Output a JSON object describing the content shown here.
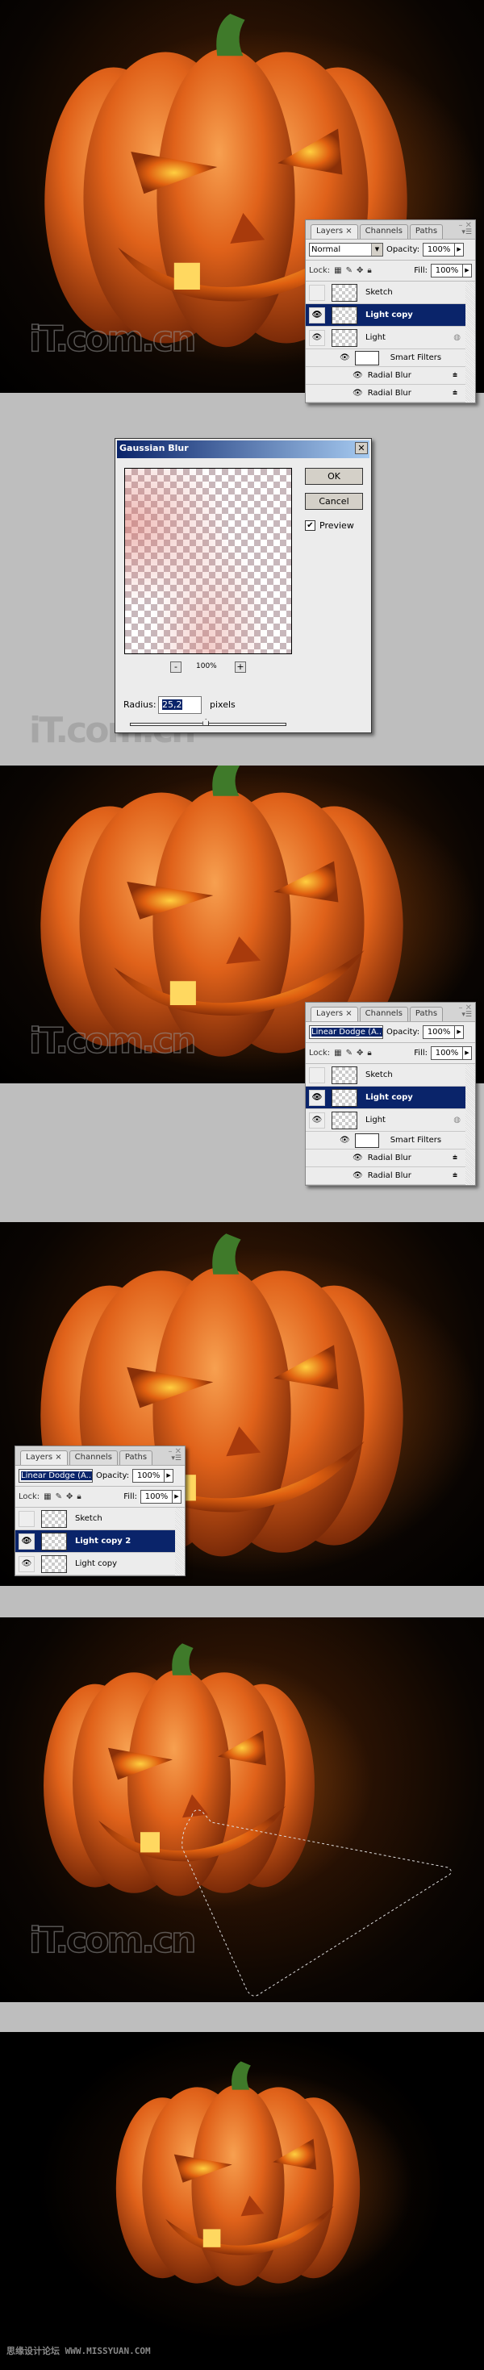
{
  "watermark": "iT.com.cn",
  "footer": {
    "site_cn": "思缘设计论坛",
    "site_url": "WWW.MISSYUAN.COM"
  },
  "layers_panels": [
    {
      "tabs": [
        "Layers ×",
        "Channels",
        "Paths"
      ],
      "blend_mode": "Normal",
      "opacity_label": "Opacity:",
      "opacity": "100%",
      "lock_label": "Lock:",
      "fill_label": "Fill:",
      "fill": "100%",
      "layers": [
        {
          "name": "Sketch",
          "visible": false,
          "selected": false
        },
        {
          "name": "Light copy",
          "visible": true,
          "selected": true
        },
        {
          "name": "Light",
          "visible": true,
          "selected": false,
          "smart": true
        }
      ],
      "smart_filters": "Smart Filters",
      "filters": [
        "Radial Blur",
        "Radial Blur"
      ]
    },
    {
      "tabs": [
        "Layers ×",
        "Channels",
        "Paths"
      ],
      "blend_mode": "Linear Dodge (A...",
      "opacity_label": "Opacity:",
      "opacity": "100%",
      "lock_label": "Lock:",
      "fill_label": "Fill:",
      "fill": "100%",
      "layers": [
        {
          "name": "Sketch",
          "visible": false,
          "selected": false
        },
        {
          "name": "Light copy",
          "visible": true,
          "selected": true
        },
        {
          "name": "Light",
          "visible": true,
          "selected": false,
          "smart": true
        }
      ],
      "smart_filters": "Smart Filters",
      "filters": [
        "Radial Blur",
        "Radial Blur"
      ]
    },
    {
      "tabs": [
        "Layers ×",
        "Channels",
        "Paths"
      ],
      "blend_mode": "Linear Dodge (A...",
      "opacity_label": "Opacity:",
      "opacity": "100%",
      "lock_label": "Lock:",
      "fill_label": "Fill:",
      "fill": "100%",
      "layers": [
        {
          "name": "Sketch",
          "visible": false,
          "selected": false
        },
        {
          "name": "Light copy 2",
          "visible": true,
          "selected": true
        },
        {
          "name": "Light copy",
          "visible": true,
          "selected": false
        }
      ]
    }
  ],
  "gaussian_blur": {
    "title": "Gaussian Blur",
    "ok": "OK",
    "cancel": "Cancel",
    "preview_label": "Preview",
    "preview_checked": true,
    "zoom": "100%",
    "minus": "-",
    "plus": "+",
    "radius_label": "Radius:",
    "radius": "25,2",
    "unit": "pixels",
    "slider_fraction": 0.48
  },
  "colors": {
    "selection": "#0a246a",
    "pumpkin": "#e0621a",
    "stem": "#3f7a2a",
    "background": "#bebebe"
  }
}
